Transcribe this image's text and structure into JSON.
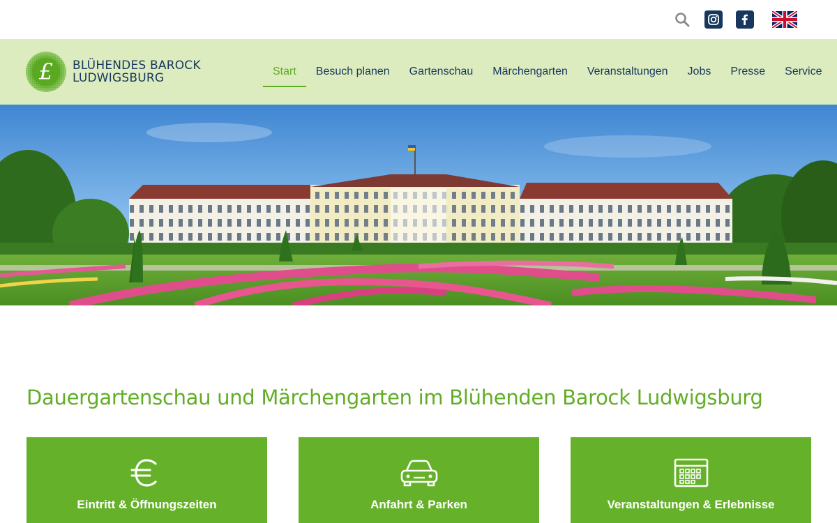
{
  "topbar": {
    "icons": [
      "search-icon",
      "instagram-icon",
      "facebook-icon",
      "uk-flag-icon"
    ]
  },
  "logo": {
    "line1": "BLÜHENDES BAROCK",
    "line2": "LUDWIGSBURG",
    "mark": "£"
  },
  "nav": {
    "items": [
      "Start",
      "Besuch planen",
      "Gartenschau",
      "Märchengarten",
      "Veranstaltungen",
      "Jobs",
      "Presse",
      "Service"
    ],
    "active": "Start"
  },
  "hero": {
    "icon": "palace-garden-image"
  },
  "main": {
    "headline": "Dauergartenschau und Märchengarten im Blühenden Barock Ludwigsburg"
  },
  "cards": [
    {
      "label": "Eintritt & Öffnungszeiten",
      "icon": "euro-icon"
    },
    {
      "label": "Anfahrt & Parken",
      "icon": "car-icon"
    },
    {
      "label": "Veranstaltungen & Erlebnisse",
      "icon": "calendar-icon"
    }
  ],
  "colors": {
    "brand_green": "#62ad27",
    "header_bg": "#dcecbe",
    "navy": "#17375e",
    "card_green": "#65b22a"
  }
}
